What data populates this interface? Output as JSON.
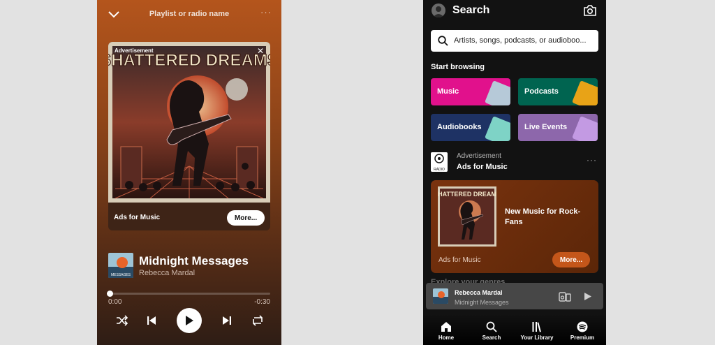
{
  "now_playing": {
    "header": {
      "title": "Playlist or radio name",
      "more": "···"
    },
    "ad": {
      "label": "Advertisement",
      "close": "✕",
      "art_title": "SHATTERED DREAMS",
      "brand": "Ads for Music",
      "more_button": "More..."
    },
    "track": {
      "title": "Midnight Messages",
      "artist": "Rebecca Mardal",
      "thumb_caption": "MESSAGES"
    },
    "progress": {
      "fraction": 0.0,
      "elapsed": "0:00",
      "remaining": "-0:30"
    },
    "controls": {
      "icons": [
        "shuffle-icon",
        "previous-icon",
        "play-icon",
        "next-icon",
        "repeat-icon"
      ]
    }
  },
  "search_screen": {
    "title": "Search",
    "search": {
      "placeholder": "Artists, songs, podcasts, or audioboo..."
    },
    "start_browsing": "Start browsing",
    "tiles": [
      {
        "label": "Music",
        "color": "#e1118c",
        "art_color": "#b6c9d8"
      },
      {
        "label": "Podcasts",
        "color": "#006450",
        "art_color": "#e8a317"
      },
      {
        "label": "Audiobooks",
        "color": "#1e3264",
        "art_color": "#7ed3c6"
      },
      {
        "label": "Live Events",
        "color": "#8d67ab",
        "art_color": "#c39ae3"
      }
    ],
    "ad_row": {
      "logo_text": "RADIO playlists",
      "advertisement": "Advertisement",
      "brand": "Ads for Music",
      "more": "···"
    },
    "promo": {
      "art_title": "SHATTERED DREAMS",
      "headline": "New Music for Rock-Fans",
      "brand": "Ads for Music",
      "more_button": "More..."
    },
    "behind_text": "Explore your genres",
    "mini_player": {
      "artist": "Rebecca Mardal",
      "track": "Midnight Messages"
    },
    "bottom_nav": [
      {
        "label": "Home",
        "icon": "home-icon"
      },
      {
        "label": "Search",
        "icon": "search-icon"
      },
      {
        "label": "Your Library",
        "icon": "library-icon"
      },
      {
        "label": "Premium",
        "icon": "spotify-icon"
      }
    ]
  },
  "colors": {
    "accent_orange": "#c4561a",
    "background_dark": "#121212",
    "left_gradient_top": "#b4551c"
  }
}
